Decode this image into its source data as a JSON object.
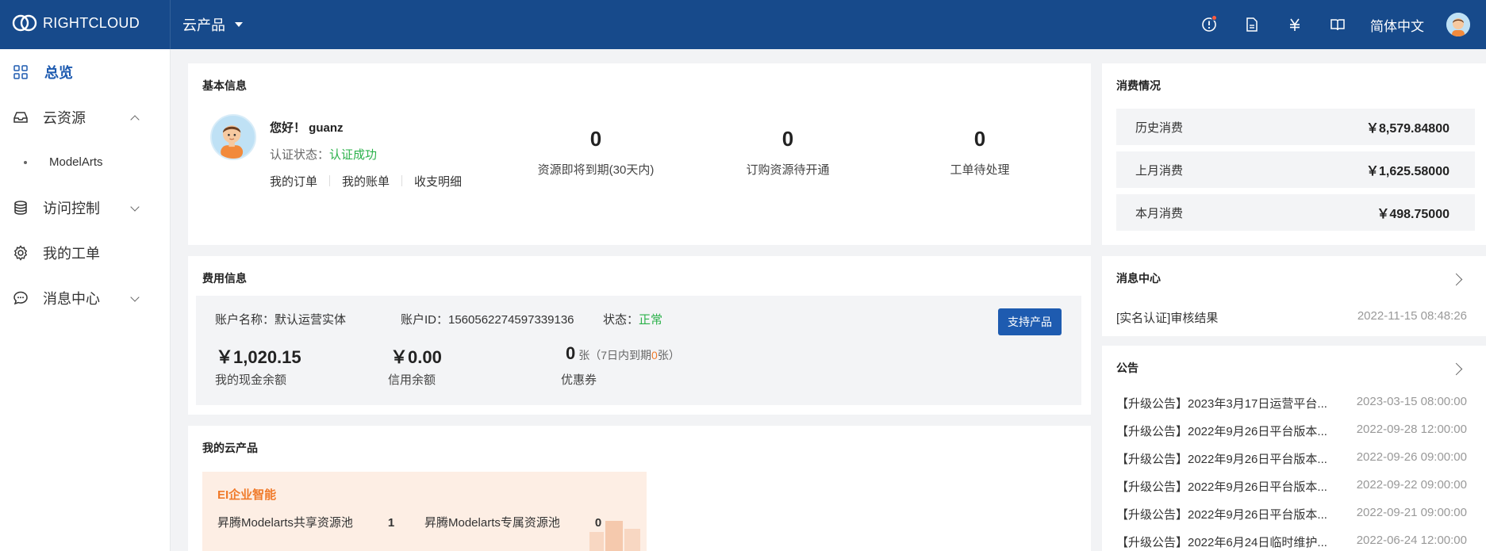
{
  "header": {
    "logo_text": "RIGHTCLOUD",
    "product_menu": "云产品",
    "language": "简体中文"
  },
  "sidebar": {
    "items": [
      {
        "label": "总览",
        "icon": "grid-icon",
        "active": true
      },
      {
        "label": "云资源",
        "icon": "inbox-icon",
        "expanded": true
      },
      {
        "label": "ModelArts",
        "sub": true
      },
      {
        "label": "访问控制",
        "icon": "database-icon"
      },
      {
        "label": "我的工单",
        "icon": "gear-icon"
      },
      {
        "label": "消息中心",
        "icon": "chat-icon"
      }
    ]
  },
  "basic": {
    "title": "基本信息",
    "greeting": "您好！ guanz",
    "auth_label": "认证状态：",
    "auth_value": "认证成功",
    "links": [
      "我的订单",
      "我的账单",
      "收支明细"
    ],
    "stats": [
      {
        "value": "0",
        "label": "资源即将到期(30天内)"
      },
      {
        "value": "0",
        "label": "订购资源待开通"
      },
      {
        "value": "0",
        "label": "工单待处理"
      }
    ]
  },
  "fee": {
    "title": "费用信息",
    "account_name": "账户名称：默认运营实体",
    "account_id": "账户ID：1560562274597339136",
    "status_label": "状态：",
    "status_value": "正常",
    "support_button": "支持产品",
    "cash_amount": "￥1,020.15",
    "cash_label": "我的现金余额",
    "credit_amount": "￥0.00",
    "credit_label": "信用余额",
    "coupon_count": "0",
    "coupon_unit": "张",
    "coupon_note_pre": "（7日内到期",
    "coupon_note_num": "0",
    "coupon_note_post": "张）",
    "coupon_label": "优惠券"
  },
  "products": {
    "title": "我的云产品",
    "card_title": "EI企业智能",
    "items": [
      {
        "name": "昇腾Modelarts共享资源池",
        "count": "1"
      },
      {
        "name": "昇腾Modelarts专属资源池",
        "count": "0"
      }
    ]
  },
  "consume": {
    "title": "消费情况",
    "rows": [
      {
        "label": "历史消费",
        "value": "￥8,579.84800"
      },
      {
        "label": "上月消费",
        "value": "￥1,625.58000"
      },
      {
        "label": "本月消费",
        "value": "￥498.75000"
      }
    ]
  },
  "messages": {
    "title": "消息中心",
    "items": [
      {
        "text": "[实名认证]审核结果",
        "date": "2022-11-15 08:48:26"
      }
    ]
  },
  "notices": {
    "title": "公告",
    "items": [
      {
        "text": "【升级公告】2023年3月17日运营平台...",
        "date": "2023-03-15 08:00:00"
      },
      {
        "text": "【升级公告】2022年9月26日平台版本...",
        "date": "2022-09-28 12:00:00"
      },
      {
        "text": "【升级公告】2022年9月26日平台版本...",
        "date": "2022-09-26 09:00:00"
      },
      {
        "text": "【升级公告】2022年9月26日平台版本...",
        "date": "2022-09-22 09:00:00"
      },
      {
        "text": "【升级公告】2022年9月26日平台版本...",
        "date": "2022-09-21 09:00:00"
      },
      {
        "text": "【升级公告】2022年6月24日临时维护...",
        "date": "2022-06-24 12:00:00"
      }
    ]
  },
  "colors": {
    "header_bg": "#174a8b",
    "accent": "#1e5bb0",
    "success": "#2bb14a",
    "orange": "#f07a2a"
  }
}
